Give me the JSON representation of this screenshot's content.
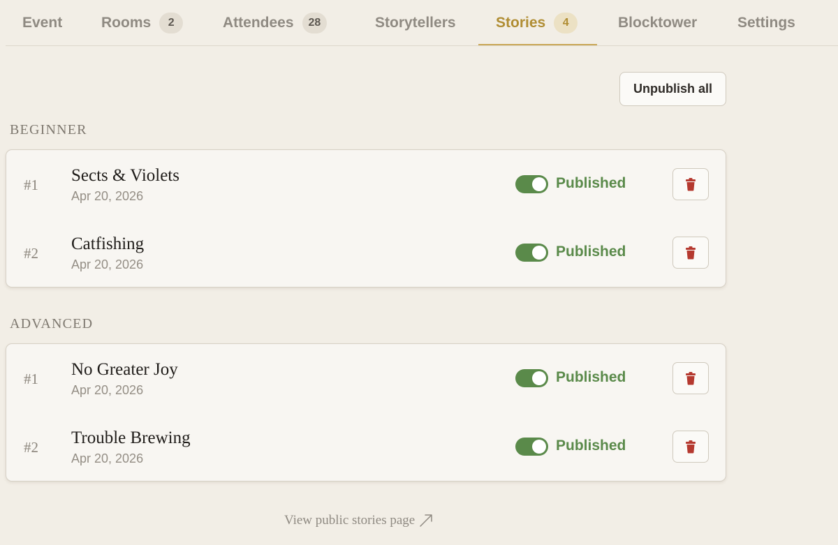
{
  "tabs": [
    {
      "label": "Event",
      "badge": null
    },
    {
      "label": "Rooms",
      "badge": "2"
    },
    {
      "label": "Attendees",
      "badge": "28"
    },
    {
      "label": "Storytellers",
      "badge": null
    },
    {
      "label": "Stories",
      "badge": "4"
    },
    {
      "label": "Blocktower",
      "badge": null
    },
    {
      "label": "Settings",
      "badge": null
    }
  ],
  "active_tab": "Stories",
  "actions": {
    "unpublish_all": "Unpublish all"
  },
  "sections": [
    {
      "label": "BEGINNER",
      "stories": [
        {
          "number": "#1",
          "title": "Sects & Violets",
          "date": "Apr 20, 2026",
          "published": true,
          "status": "Published"
        },
        {
          "number": "#2",
          "title": "Catfishing",
          "date": "Apr 20, 2026",
          "published": true,
          "status": "Published"
        }
      ]
    },
    {
      "label": "ADVANCED",
      "stories": [
        {
          "number": "#1",
          "title": "No Greater Joy",
          "date": "Apr 20, 2026",
          "published": true,
          "status": "Published"
        },
        {
          "number": "#2",
          "title": "Trouble Brewing",
          "date": "Apr 20, 2026",
          "published": true,
          "status": "Published"
        }
      ]
    }
  ],
  "footer": {
    "public_link": "View public stories page",
    "link_icon": "arrow-up-right-icon"
  },
  "colors": {
    "background": "#f2eee6",
    "accent": "#b08d33",
    "published_green": "#5a8a4a",
    "delete_red": "#b5392f"
  }
}
